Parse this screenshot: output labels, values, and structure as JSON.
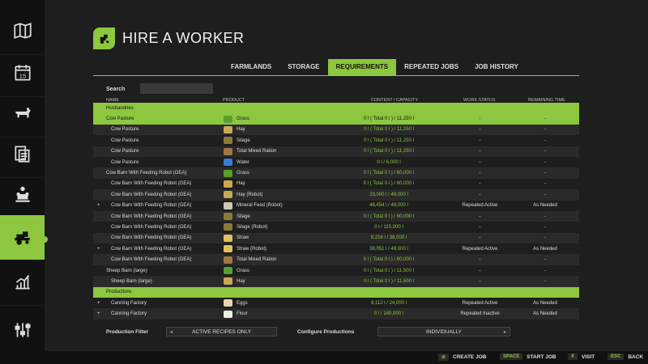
{
  "header": {
    "title": "HIRE A WORKER"
  },
  "tabs": [
    {
      "label": "FARMLANDS"
    },
    {
      "label": "STORAGE"
    },
    {
      "label": "REQUIREMENTS"
    },
    {
      "label": "REPEATED JOBS"
    },
    {
      "label": "JOB HISTORY"
    }
  ],
  "search": {
    "label": "Search",
    "value": ""
  },
  "columns": {
    "name": "NAME",
    "product": "PRODUCT",
    "content": "CONTENT / CAPACITY",
    "status": "WORK STATUS",
    "remaining": "REMAINING TIME"
  },
  "rows": [
    {
      "type": "section",
      "name": "Husbandries"
    },
    {
      "type": "group",
      "name": "Cow Pasture",
      "product": "Grass",
      "icon": "grass-icon",
      "content": "0 l ( Total 0 l ) / 11,250 l",
      "status": "-",
      "remaining": "-"
    },
    {
      "type": "item",
      "name": "Cow Pasture",
      "product": "Hay",
      "icon": "hay-icon",
      "content": "0 l ( Total 0 l ) / 11,250 l",
      "status": "-",
      "remaining": "-"
    },
    {
      "type": "item",
      "name": "Cow Pasture",
      "product": "Silage",
      "icon": "silage-icon",
      "content": "0 l ( Total 0 l ) / 11,250 l",
      "status": "-",
      "remaining": "-"
    },
    {
      "type": "item",
      "name": "Cow Pasture",
      "product": "Total Mixed Ration",
      "icon": "tmr-icon",
      "content": "0 l ( Total 0 l ) / 11,250 l",
      "status": "-",
      "remaining": "-"
    },
    {
      "type": "item",
      "name": "Cow Pasture",
      "product": "Water",
      "icon": "water-icon",
      "content": "0 l / 6,000 l",
      "status": "-",
      "remaining": "-"
    },
    {
      "type": "head",
      "name": "Cow Barn With Feeding Robot (GEA)",
      "product": "Grass",
      "icon": "grass-icon",
      "content": "0 l ( Total 0 l ) / 60,000 l",
      "status": "-",
      "remaining": "-"
    },
    {
      "type": "item",
      "name": "Cow Barn With Feeding Robot (GEA)",
      "product": "Hay",
      "icon": "hay-icon",
      "content": "0 l ( Total 0 l ) / 60,000 l",
      "status": "-",
      "remaining": "-"
    },
    {
      "type": "item",
      "name": "Cow Barn With Feeding Robot (GEA)",
      "product": "Hay (Robot)",
      "icon": "hay-icon",
      "content": "29,000 l / 49,000 l",
      "status": "-",
      "remaining": "-"
    },
    {
      "type": "item",
      "plus": "+",
      "name": "Cow Barn With Feeding Robot (GEA)",
      "product": "Mineral Feed (Robot)",
      "icon": "mineral-icon",
      "content": "46,454 l / 49,000 l",
      "status": "Repeated Active",
      "remaining": "As Needed"
    },
    {
      "type": "item",
      "name": "Cow Barn With Feeding Robot (GEA)",
      "product": "Silage",
      "icon": "silage-icon",
      "content": "0 l ( Total 0 l ) / 60,000 l",
      "status": "-",
      "remaining": "-"
    },
    {
      "type": "item",
      "name": "Cow Barn With Feeding Robot (GEA)",
      "product": "Silage (Robot)",
      "icon": "silage-icon",
      "content": "0 l / 115,000 l",
      "status": "-",
      "remaining": "-"
    },
    {
      "type": "item",
      "name": "Cow Barn With Feeding Robot (GEA)",
      "product": "Straw",
      "icon": "straw-icon",
      "content": "8,216 l / 38,000 l",
      "status": "-",
      "remaining": "-"
    },
    {
      "type": "item",
      "plus": "+",
      "name": "Cow Barn With Feeding Robot (GEA)",
      "product": "Straw (Robot)",
      "icon": "straw-icon",
      "content": "38,051 l / 49,000 l",
      "status": "Repeated Active",
      "remaining": "As Needed"
    },
    {
      "type": "item",
      "name": "Cow Barn With Feeding Robot (GEA)",
      "product": "Total Mixed Ration",
      "icon": "tmr-icon",
      "content": "0 l ( Total 0 l ) / 60,000 l",
      "status": "-",
      "remaining": "-"
    },
    {
      "type": "head",
      "name": "Sheep Barn (large)",
      "product": "Grass",
      "icon": "grass-icon",
      "content": "0 l ( Total 0 l ) / 11,500 l",
      "status": "-",
      "remaining": "-"
    },
    {
      "type": "item",
      "name": "Sheep Barn (large)",
      "product": "Hay",
      "icon": "hay-icon",
      "content": "0 l ( Total 0 l ) / 11,500 l",
      "status": "-",
      "remaining": "-"
    },
    {
      "type": "section",
      "name": "Productions"
    },
    {
      "type": "item",
      "plus": "+",
      "name": "Canning Factory",
      "product": "Eggs",
      "icon": "eggs-icon",
      "content": "8,112 l / 24,000 l",
      "status": "Repeated Active",
      "remaining": "As Needed"
    },
    {
      "type": "item",
      "plus": "+",
      "name": "Canning Factory",
      "product": "Flour",
      "icon": "flour-icon",
      "content": "0 l / 140,000 l",
      "status": "Repeated Inactive",
      "remaining": "As Needed"
    }
  ],
  "footer": {
    "production_filter_label": "Production Filter",
    "production_filter_value": "ACTIVE RECIPES ONLY",
    "configure_label": "Configure Productions",
    "configure_value": "INDIVIDUALLY",
    "arrow_left": "◂",
    "arrow_right": "▸"
  },
  "hints": [
    {
      "key": "⊘",
      "label": "CREATE JOB"
    },
    {
      "key": "SPACE",
      "label": "START JOB"
    },
    {
      "key": "X",
      "label": "VISIT"
    },
    {
      "key": "ESC",
      "label": "BACK"
    }
  ],
  "colors": {
    "accent": "#8dc63f",
    "background": "#1e1e1e",
    "sidebar": "#111111"
  },
  "sidebar": {
    "items": [
      "map-icon",
      "calendar-icon",
      "livestock-icon",
      "contracts-icon",
      "production-icon",
      "worker-icon",
      "statistics-icon",
      "settings-icon"
    ],
    "calendar_day": "15"
  }
}
